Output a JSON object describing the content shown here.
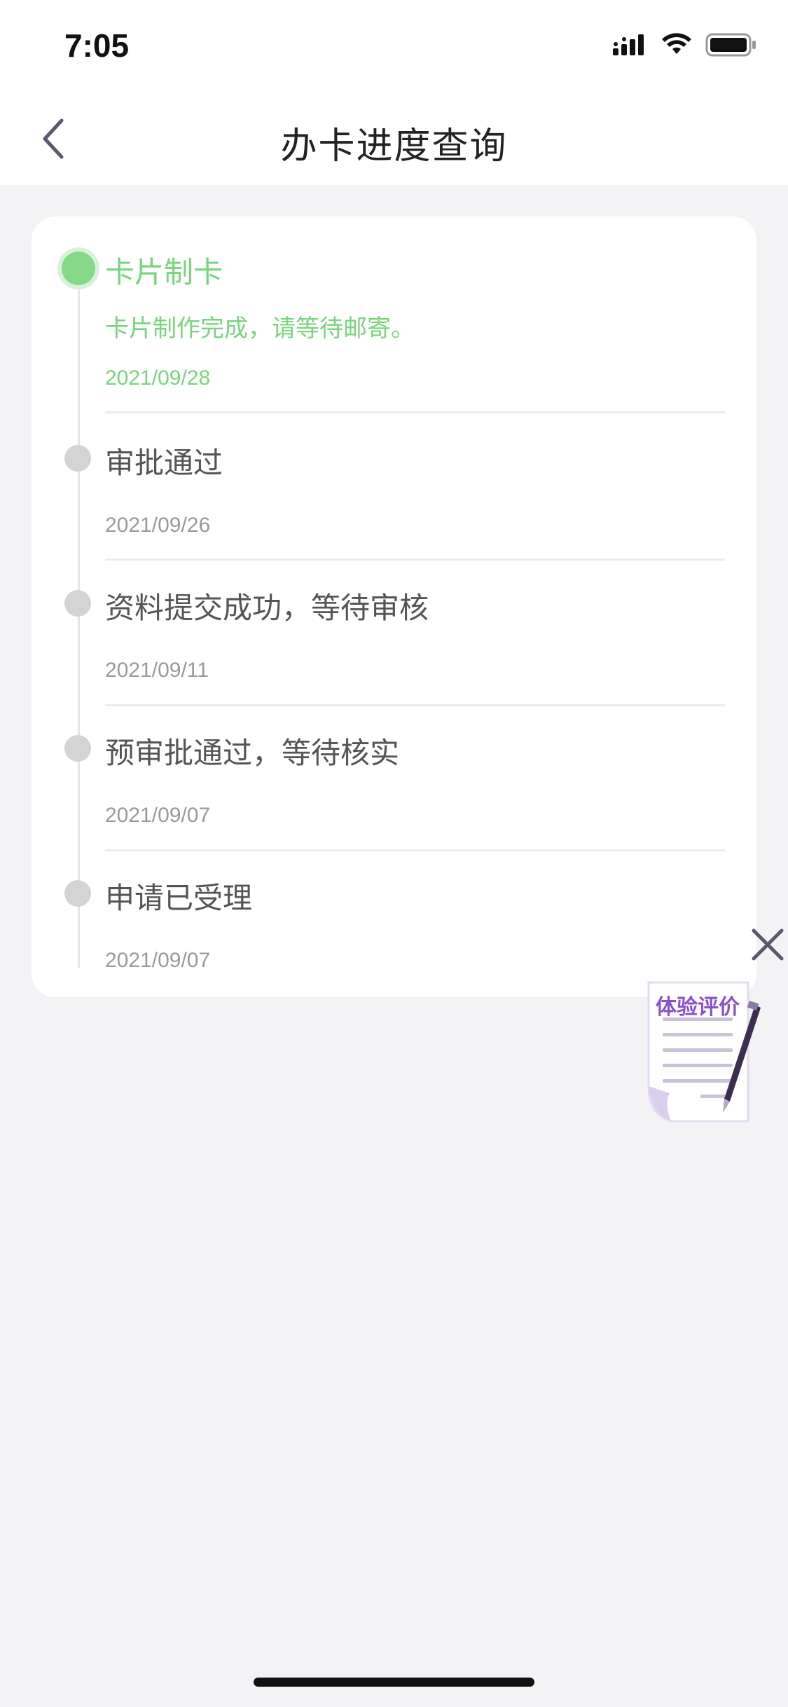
{
  "status_bar": {
    "time": "7:05"
  },
  "nav": {
    "title": "办卡进度查询"
  },
  "steps": [
    {
      "title": "卡片制卡",
      "desc": "卡片制作完成，请等待邮寄。",
      "date": "2021/09/28",
      "active": true
    },
    {
      "title": "审批通过",
      "date": "2021/09/26",
      "active": false
    },
    {
      "title": "资料提交成功，等待审核",
      "date": "2021/09/11",
      "active": false
    },
    {
      "title": "预审批通过，等待核实",
      "date": "2021/09/07",
      "active": false
    },
    {
      "title": "申请已受理",
      "date": "2021/09/07",
      "active": false
    }
  ],
  "feedback": {
    "label": "体验评价"
  },
  "colors": {
    "active_green": "#7ad47d",
    "inactive_dot": "#d4d4d4",
    "feedback_purple": "#8a4fcf",
    "background": "#f3f3f6"
  }
}
